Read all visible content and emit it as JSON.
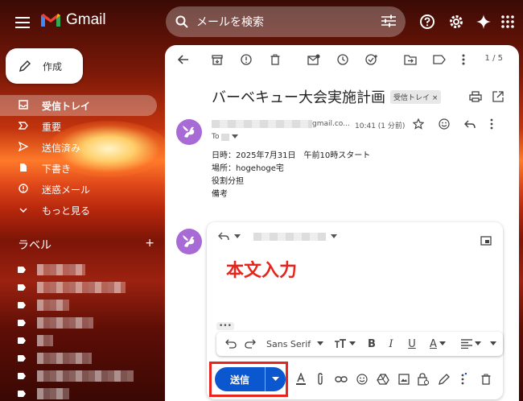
{
  "app": {
    "name": "Gmail"
  },
  "search": {
    "placeholder": "メールを検索"
  },
  "compose": {
    "label": "作成"
  },
  "nav": [
    {
      "label": "受信トレイ",
      "icon": "inbox-icon"
    },
    {
      "label": "重要",
      "icon": "important-icon"
    },
    {
      "label": "送信済み",
      "icon": "send-icon"
    },
    {
      "label": "下書き",
      "icon": "draft-icon"
    },
    {
      "label": "迷惑メール",
      "icon": "spam-icon"
    },
    {
      "label": "もっと見る",
      "icon": "chevron-down-icon"
    }
  ],
  "labels": {
    "heading": "ラベル",
    "add": "+"
  },
  "toolbar": {
    "pager": "1 / 5"
  },
  "message": {
    "subject": "バーベキュー大会実施計画",
    "chip": "受信トレイ ×",
    "sender_domain": "gmail.co...",
    "time": "10:41 (1 分前)",
    "to": "To",
    "body": [
      "日時：2025年7月31日　午前10時スタート",
      "場所：hogehoge宅",
      "役割分担",
      "備考"
    ]
  },
  "reply": {
    "body_text": "本文入力",
    "dots": "•••",
    "font": "Sans Serif",
    "send": "送信"
  }
}
